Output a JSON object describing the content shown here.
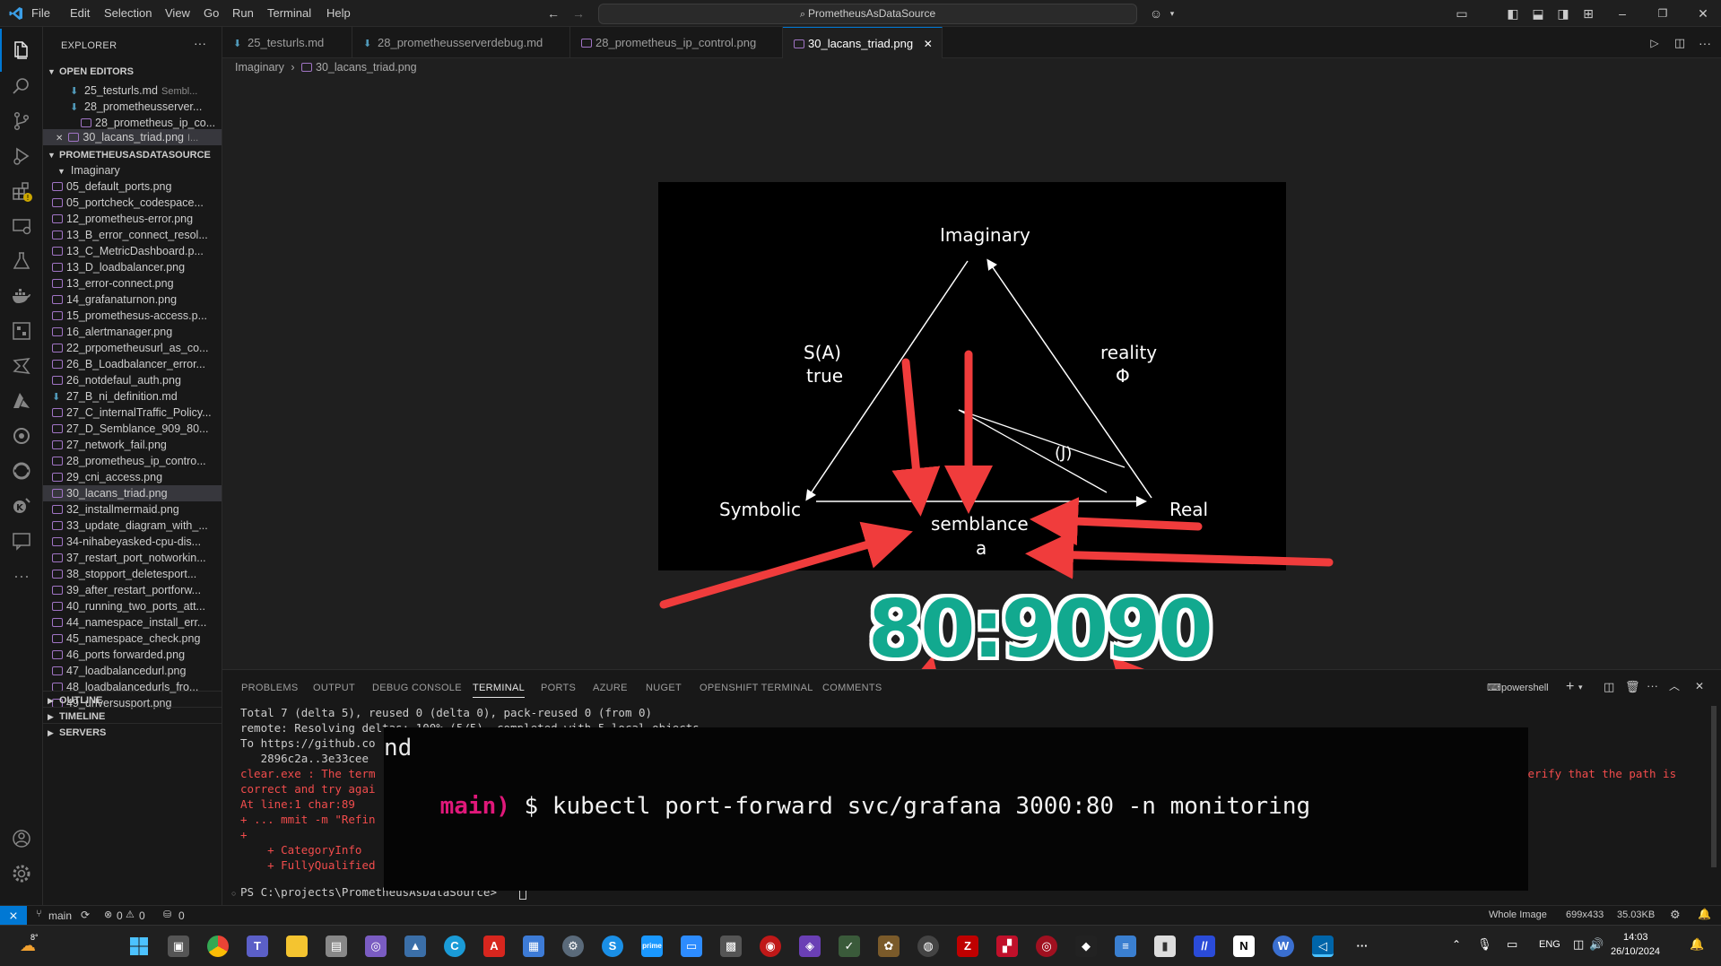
{
  "titlebar": {
    "menus": [
      "File",
      "Edit",
      "Selection",
      "View",
      "Go",
      "Run",
      "Terminal",
      "Help"
    ],
    "search_text": "PrometheusAsDataSource"
  },
  "sidebar": {
    "header": "EXPLORER",
    "open_editors_title": "OPEN EDITORS",
    "open_editors": [
      {
        "name": "25_testurls.md",
        "desc": "Sembl..."
      },
      {
        "name": "28_prometheusserver...",
        "desc": ""
      },
      {
        "name": "28_prometheus_ip_co...",
        "desc": ""
      },
      {
        "name": "30_lacans_triad.png",
        "desc": "I..."
      }
    ],
    "project_title": "PROMETHEUSASDATASOURCE",
    "folder": "Imaginary",
    "files": [
      "05_default_ports.png",
      "05_portcheck_codespace...",
      "12_prometheus-error.png",
      "13_B_error_connect_resol...",
      "13_C_MetricDashboard.p...",
      "13_D_loadbalancer.png",
      "13_error-connect.png",
      "14_grafanaturnon.png",
      "15_promethesus-access.p...",
      "16_alertmanager.png",
      "22_prpometheusurl_as_co...",
      "26_B_Loadbalancer_error...",
      "26_notdefaul_auth.png",
      "27_B_ni_definition.md",
      "27_C_internalTraffic_Policy...",
      "27_D_Semblance_909_80...",
      "27_network_fail.png",
      "28_prometheus_ip_contro...",
      "29_cni_access.png",
      "30_lacans_triad.png",
      "32_installmermaid.png",
      "33_update_diagram_with_...",
      "34-nihabeyasked-cpu-dis...",
      "37_restart_port_notworkin...",
      "38_stopport_deletesport...",
      "39_after_restart_portforw...",
      "40_running_two_ports_att...",
      "44_namespace_install_err...",
      "45_namespace_check.png",
      "46_ports forwarded.png",
      "47_loadbalancedurl.png",
      "48_loadbalancedurls_fro...",
      "49_urlversusport.png"
    ],
    "outline": "OUTLINE",
    "timeline": "TIMELINE",
    "servers": "SERVERS"
  },
  "tabs": [
    {
      "label": "25_testurls.md"
    },
    {
      "label": "28_prometheusserverdebug.md"
    },
    {
      "label": "28_prometheus_ip_control.png"
    },
    {
      "label": "30_lacans_triad.png"
    }
  ],
  "breadcrumb": {
    "folder": "Imaginary",
    "file": "30_lacans_triad.png"
  },
  "image": {
    "imaginary": "Imaginary",
    "symbolic": "Symbolic",
    "real": "Real",
    "sa": "S(A)",
    "sa_true": "true",
    "reality": "reality",
    "phi": "Φ",
    "j": "(J)",
    "semblance": "semblance",
    "a": "a",
    "overlay_text": "80:9090"
  },
  "panel": {
    "tabs": [
      "PROBLEMS",
      "OUTPUT",
      "DEBUG CONSOLE",
      "TERMINAL",
      "PORTS",
      "AZURE",
      "NUGET",
      "OPENSHIFT TERMINAL",
      "COMMENTS"
    ],
    "shell": "powershell",
    "lines": [
      "Total 7 (delta 5), reused 0 (delta 0), pack-reused 0 (from 0)",
      "remote: Resolving deltas: 100% (5/5), completed with 5 local objects.",
      "To https://github.co",
      "   2896c2a..3e33cee",
      "clear.exe : The term",
      "correct and try agai",
      "At line:1 char:89",
      "+ ... mmit -m \"Refin",
      "+",
      "    + CategoryInfo",
      "    + FullyQualified"
    ],
    "error_tail": "verify that the path is",
    "prompt": "PS C:\\projects\\PrometheusAsDataSource> "
  },
  "overlay": {
    "prefix": "nd",
    "branch": "main)",
    "command": " $ kubectl port-forward svc/grafana 3000:80 -n monitoring"
  },
  "statusbar": {
    "branch": "main",
    "errors": "0",
    "warnings": "0",
    "ports": "0",
    "zoom": "Whole Image",
    "dimensions": "699x433",
    "size": "35.03KB"
  },
  "taskbar": {
    "weather": "8°",
    "lang": "ENG",
    "time": "14:03",
    "date": "26/10/2024"
  }
}
